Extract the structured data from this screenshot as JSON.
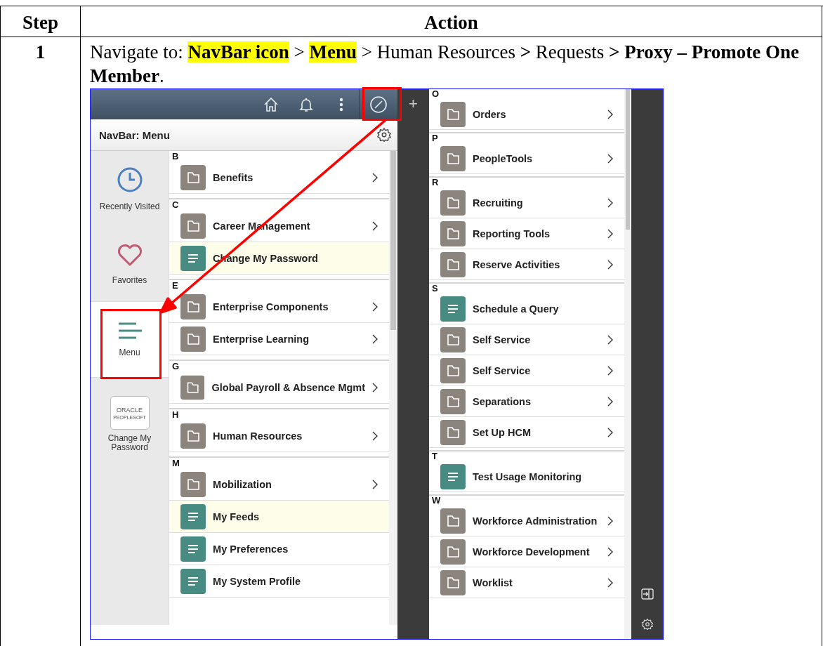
{
  "table": {
    "columns": [
      "Step",
      "Action"
    ],
    "rows": [
      {
        "step": "1",
        "instruction": [
          {
            "text": "Navigate to: ",
            "bold": false,
            "highlight": false
          },
          {
            "text": "NavBar icon",
            "bold": true,
            "highlight": true
          },
          {
            "text": " > ",
            "bold": false,
            "highlight": false
          },
          {
            "text": "Menu",
            "bold": true,
            "highlight": true
          },
          {
            "text": " > Human Resources ",
            "bold": false,
            "highlight": false
          },
          {
            "text": ">",
            "bold": true,
            "highlight": false
          },
          {
            "text": " Requests ",
            "bold": false,
            "highlight": false
          },
          {
            "text": "> Proxy – Promote One Member",
            "bold": true,
            "highlight": false
          },
          {
            "text": ".",
            "bold": false,
            "highlight": false
          }
        ],
        "screenshot": {
          "add_tab": "+",
          "navbar_header": {
            "title": "NavBar: Menu"
          },
          "sidebar": [
            {
              "label": "Recently Visited",
              "kind": "clock",
              "selected": false
            },
            {
              "label": "Favorites",
              "kind": "heart",
              "selected": false
            },
            {
              "label": "Menu",
              "kind": "menu",
              "selected": true
            },
            {
              "label": "Change My Password",
              "kind": "tile",
              "tile_lines": [
                "ORACLE",
                "PEOPLESOFT"
              ],
              "selected": false
            }
          ],
          "menu_columns": [
            [
              {
                "letter": "B",
                "items": [
                  {
                    "label": "Benefits",
                    "kind": "folder",
                    "highlighted": false
                  }
                ]
              },
              {
                "letter": "C",
                "items": [
                  {
                    "label": "Career Management",
                    "kind": "folder",
                    "highlighted": false
                  },
                  {
                    "label": "Change My Password",
                    "kind": "page",
                    "highlighted": true
                  }
                ]
              },
              {
                "letter": "E",
                "items": [
                  {
                    "label": "Enterprise Components",
                    "kind": "folder",
                    "highlighted": false
                  },
                  {
                    "label": "Enterprise Learning",
                    "kind": "folder",
                    "highlighted": false
                  }
                ]
              },
              {
                "letter": "G",
                "items": [
                  {
                    "label": "Global Payroll & Absence Mgmt",
                    "kind": "folder",
                    "highlighted": false
                  }
                ]
              },
              {
                "letter": "H",
                "items": [
                  {
                    "label": "Human Resources",
                    "kind": "folder",
                    "highlighted": false
                  }
                ]
              },
              {
                "letter": "M",
                "items": [
                  {
                    "label": "Mobilization",
                    "kind": "folder",
                    "highlighted": false
                  },
                  {
                    "label": "My Feeds",
                    "kind": "page",
                    "highlighted": true
                  },
                  {
                    "label": "My Preferences",
                    "kind": "page",
                    "highlighted": false
                  },
                  {
                    "label": "My System Profile",
                    "kind": "page",
                    "highlighted": false
                  }
                ]
              }
            ],
            [
              {
                "letter": "O",
                "items": [
                  {
                    "label": "Orders",
                    "kind": "folder",
                    "highlighted": false
                  }
                ]
              },
              {
                "letter": "P",
                "items": [
                  {
                    "label": "PeopleTools",
                    "kind": "folder",
                    "highlighted": false
                  }
                ]
              },
              {
                "letter": "R",
                "items": [
                  {
                    "label": "Recruiting",
                    "kind": "folder",
                    "highlighted": false
                  },
                  {
                    "label": "Reporting Tools",
                    "kind": "folder",
                    "highlighted": false
                  },
                  {
                    "label": "Reserve Activities",
                    "kind": "folder",
                    "highlighted": false
                  }
                ]
              },
              {
                "letter": "S",
                "items": [
                  {
                    "label": "Schedule a Query",
                    "kind": "page",
                    "highlighted": false
                  },
                  {
                    "label": "Self Service",
                    "kind": "folder",
                    "highlighted": false
                  },
                  {
                    "label": "Self Service",
                    "kind": "folder",
                    "highlighted": false
                  },
                  {
                    "label": "Separations",
                    "kind": "folder",
                    "highlighted": false
                  },
                  {
                    "label": "Set Up HCM",
                    "kind": "folder",
                    "highlighted": false
                  }
                ]
              },
              {
                "letter": "T",
                "items": [
                  {
                    "label": "Test Usage Monitoring",
                    "kind": "page",
                    "highlighted": false
                  }
                ]
              },
              {
                "letter": "W",
                "items": [
                  {
                    "label": "Workforce Administration",
                    "kind": "folder",
                    "highlighted": false
                  },
                  {
                    "label": "Workforce Development",
                    "kind": "folder",
                    "highlighted": false
                  },
                  {
                    "label": "Worklist",
                    "kind": "folder",
                    "highlighted": false
                  }
                ]
              }
            ]
          ]
        }
      }
    ]
  }
}
